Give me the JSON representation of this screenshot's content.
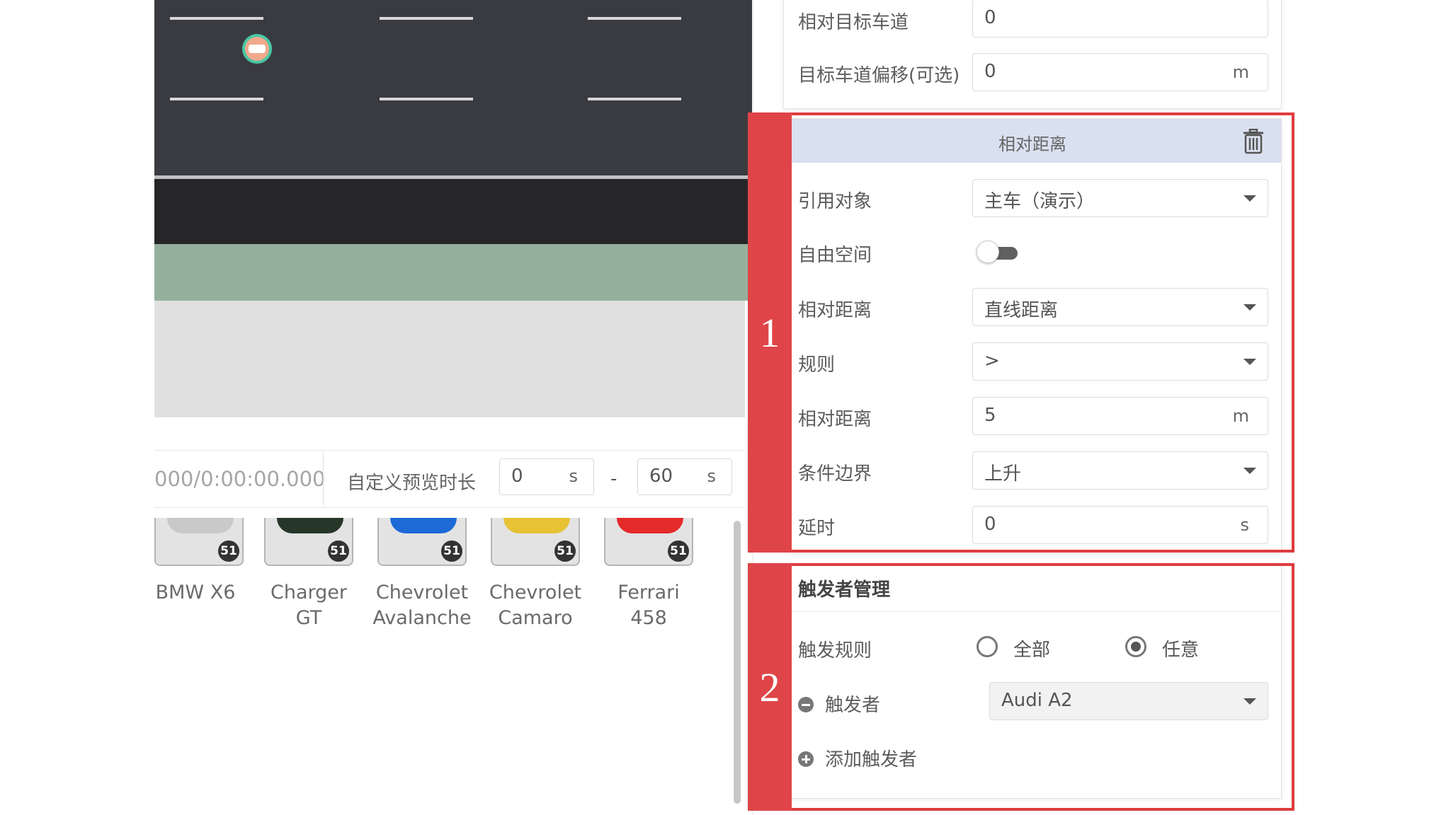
{
  "timeline": {
    "timecode": "000/0:00:00.000",
    "preview_label": "自定义预览时长",
    "start_value": "0",
    "start_unit": "s",
    "range_dash": "-",
    "end_value": "60",
    "end_unit": "s"
  },
  "vehicles": [
    {
      "name_line1": "BMW X6",
      "name_line2": "",
      "badge": "51",
      "color": "#c9c9c9"
    },
    {
      "name_line1": "Charger",
      "name_line2": "GT",
      "badge": "51",
      "color": "#26372a"
    },
    {
      "name_line1": "Chevrolet",
      "name_line2": "Avalanche",
      "badge": "51",
      "color": "#1d6ad6"
    },
    {
      "name_line1": "Chevrolet",
      "name_line2": "Camaro",
      "badge": "51",
      "color": "#e6c234"
    },
    {
      "name_line1": "Ferrari",
      "name_line2": "458",
      "badge": "51",
      "color": "#e52a2a"
    }
  ],
  "target_lane": {
    "relative_target_lane_label": "相对目标车道",
    "relative_target_lane_value": "0",
    "lane_offset_label": "目标车道偏移(可选)",
    "lane_offset_value": "0",
    "lane_offset_unit": "m"
  },
  "relative_distance_card": {
    "title": "相对距离",
    "reference_label": "引用对象",
    "reference_value": "主车（演示）",
    "free_space_label": "自由空间",
    "free_space_on": false,
    "distance_type_label": "相对距离",
    "distance_type_value": "直线距离",
    "rule_label": "规则",
    "rule_value": ">",
    "distance_label": "相对距离",
    "distance_value": "5",
    "distance_unit": "m",
    "edge_label": "条件边界",
    "edge_value": "上升",
    "delay_label": "延时",
    "delay_value": "0",
    "delay_unit": "s"
  },
  "trigger_card": {
    "title": "触发者管理",
    "rule_label": "触发规则",
    "option_all": "全部",
    "option_any": "任意",
    "selected": "任意",
    "trigger_label": "触发者",
    "trigger_value": "Audi A2",
    "add_trigger_label": "添加触发者"
  },
  "annotations": {
    "box1": "1",
    "box2": "2",
    "color": "#df3c3f"
  },
  "colors": {
    "road": "#3a3b40",
    "grass": "#95b09d",
    "header_bg": "#d9e0ef"
  }
}
